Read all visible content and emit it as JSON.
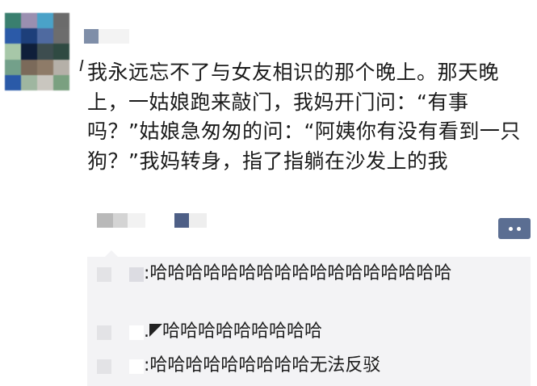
{
  "post": {
    "text": "我永远忘不了与女友相识的那个晚上。那天晚上，一姑娘跑来敲门，我妈开门问：“有事吗？”姑娘急匆匆的问：“阿姨你有没有看到一只狗？”我妈转身，指了指躺在沙发上的我",
    "avatar_colors": [
      "#3a7f6f",
      "#9a8fb0",
      "#4aa2c8",
      "#6b6b6b",
      "#2b5aa8",
      "#1d3f7a",
      "#4f6aa0",
      "#6d6d6d",
      "#a7c7a8",
      "#0f1f3a",
      "#3d4d4f",
      "#2f4a42",
      "#73a08a",
      "#7b6a5a",
      "#8e7b68",
      "#b5b0a8",
      "#2a5aa8",
      "#9fb6a0",
      "#c9c6bf",
      "#7aa080"
    ]
  },
  "comments": [
    {
      "text": "哈哈哈哈哈哈哈哈哈哈哈哈哈哈哈哈哈"
    },
    {
      "text": "哈哈哈哈哈哈哈哈哈"
    },
    {
      "text": "哈哈哈哈哈哈哈哈哈无法反驳"
    }
  ],
  "colors": {
    "comment_bg": "#f3f3f5",
    "more_button": "#5b6e92"
  },
  "icons": {
    "more": "more-dots-icon"
  }
}
